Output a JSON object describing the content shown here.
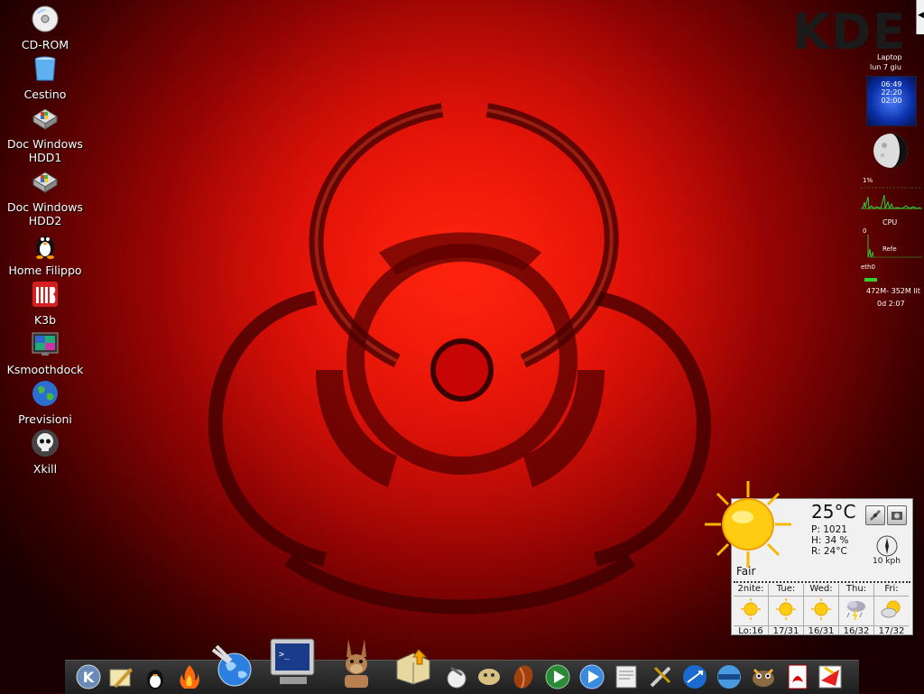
{
  "desktop": {
    "brand": "KDE",
    "icons": [
      {
        "label": "CD-ROM",
        "icon": "cd-icon"
      },
      {
        "label": "Cestino",
        "icon": "trash-icon"
      },
      {
        "label": "Doc Windows HDD1",
        "icon": "hdd-icon"
      },
      {
        "label": "Doc Windows HDD2",
        "icon": "hdd-icon"
      },
      {
        "label": "Home Filippo",
        "icon": "tux-icon"
      },
      {
        "label": "K3b",
        "icon": "k3b-icon"
      },
      {
        "label": "Ksmoothdock",
        "icon": "monitor-icon"
      },
      {
        "label": "Previsioni",
        "icon": "globe-icon"
      },
      {
        "label": "Xkill",
        "icon": "skull-icon"
      }
    ]
  },
  "sidebar": {
    "title": "Laptop",
    "date": "lun  7 giu",
    "clock_lines": [
      "06:49",
      "22:20",
      "02:00"
    ],
    "cpu_percent_label": "1%",
    "cpu_label": "CPU",
    "net_zero": "0",
    "net_refe": "Refe",
    "net_iface": "eth0",
    "memory": "472M- 352M lit",
    "uptime": "0d 2:07"
  },
  "weather": {
    "temperature": "25°C",
    "pressure": "P:  1021",
    "humidity": "H:  34 %",
    "realfeel": "R:  24°C",
    "wind": "10 kph",
    "condition": "Fair",
    "forecast": [
      {
        "day": "2nite:",
        "temps": "Lo:16",
        "icon": "sun-icon"
      },
      {
        "day": "Tue:",
        "temps": "17/31",
        "icon": "sun-icon"
      },
      {
        "day": "Wed:",
        "temps": "16/31",
        "icon": "sun-icon"
      },
      {
        "day": "Thu:",
        "temps": "16/32",
        "icon": "storm-icon"
      },
      {
        "day": "Fri:",
        "temps": "17/32",
        "icon": "partly-sunny-icon"
      }
    ]
  },
  "dock": {
    "items": [
      "kde-menu-icon",
      "text-editor-icon",
      "tux-icon",
      "firewall-icon",
      "konqueror-icon",
      "terminal-icon",
      "amule-icon",
      "package-icon",
      "cleaner-icon",
      "messenger-icon",
      "coffee-icon",
      "media-player-icon",
      "video-player-icon",
      "printer-icon",
      "tools-icon",
      "network-icon",
      "browser-icon",
      "gimp-icon",
      "pdf-icon",
      "kword-icon"
    ]
  }
}
